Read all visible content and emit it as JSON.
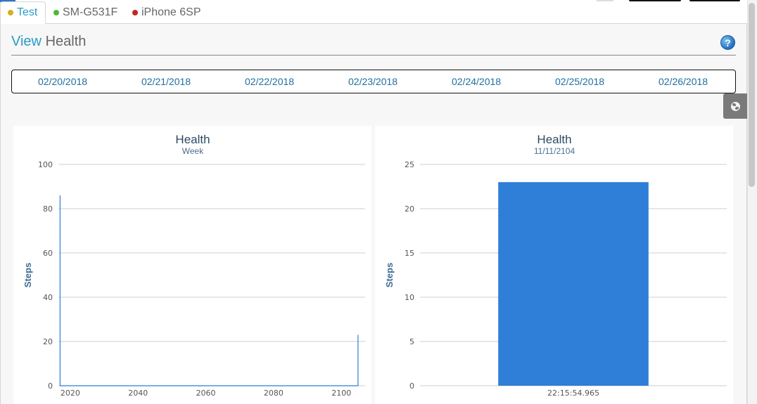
{
  "tabs": [
    {
      "label": "Test",
      "dot_color": "#d4b021",
      "active": true
    },
    {
      "label": "SM-G531F",
      "dot_color": "#4fb83a",
      "active": false
    },
    {
      "label": "iPhone 6SP",
      "dot_color": "#c0271f",
      "active": false
    }
  ],
  "header": {
    "title_accent": "View",
    "title_rest": "Health",
    "help_icon": "help-icon"
  },
  "dates": [
    "02/20/2018",
    "02/21/2018",
    "02/22/2018",
    "02/23/2018",
    "02/24/2018",
    "02/25/2018",
    "02/26/2018"
  ],
  "side_button_icon": "globe-icon",
  "chart_data": [
    {
      "type": "line",
      "title": "Health",
      "subtitle": "Week",
      "ylabel": "Steps",
      "xlabel": "",
      "ylim": [
        0,
        100
      ],
      "y_ticks": [
        0,
        20,
        40,
        60,
        80,
        100
      ],
      "xlim": [
        2016.5,
        2107
      ],
      "x_ticks": [
        2020,
        2040,
        2060,
        2080,
        2100
      ],
      "series": [
        {
          "color": "#2f7ed8",
          "points": [
            [
              2017,
              0
            ],
            [
              2017,
              86
            ],
            [
              2017,
              0
            ],
            [
              2104.9,
              0
            ],
            [
              2104.9,
              23
            ],
            [
              2104.9,
              0
            ]
          ]
        }
      ],
      "grid": true
    },
    {
      "type": "bar",
      "title": "Health",
      "subtitle": "11/11/2104",
      "ylabel": "Steps",
      "xlabel": "",
      "ylim": [
        0,
        25
      ],
      "y_ticks": [
        0,
        5,
        10,
        15,
        20,
        25
      ],
      "categories": [
        "22:15:54.965"
      ],
      "values": [
        23
      ],
      "color": "#2f7ed8",
      "grid": true
    }
  ]
}
